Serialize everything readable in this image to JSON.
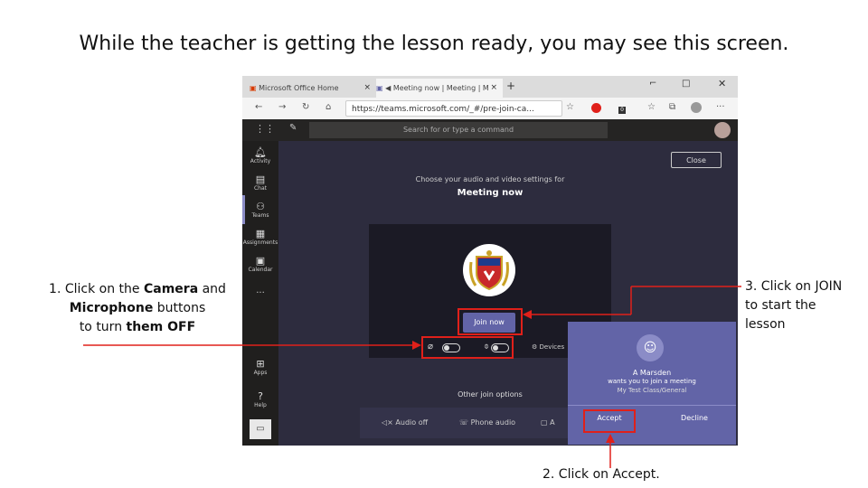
{
  "slide": {
    "title": "While the teacher is getting the lesson ready, you may see this screen.",
    "note1": {
      "p1": "1. Click on the ",
      "b1": "Camera",
      "p2": " and",
      "b2": "Microphone",
      "p3": " buttons",
      "p4": "to turn ",
      "b3": "them OFF"
    },
    "note2": "2. Click on Accept.",
    "note3": {
      "l1": "3. Click on JOIN",
      "l2": "to start the",
      "l3": "lesson"
    }
  },
  "browser": {
    "tabs": [
      {
        "label": "Microsoft Office Home",
        "close": "×"
      },
      {
        "label": "Meeting now | Meeting | M",
        "close": "×"
      }
    ],
    "new_tab": "+",
    "url": "https://teams.microsoft.com/_#/pre-join-ca...",
    "badge": "0"
  },
  "teams": {
    "search_placeholder": "Search for or type a command",
    "rail": [
      {
        "icon": "bell-icon",
        "label": "Activity"
      },
      {
        "icon": "chat-icon",
        "label": "Chat"
      },
      {
        "icon": "teams-icon",
        "label": "Teams"
      },
      {
        "icon": "assignments-icon",
        "label": "Assignments"
      },
      {
        "icon": "calendar-icon",
        "label": "Calendar"
      },
      {
        "icon": "more-icon",
        "label": "..."
      },
      {
        "icon": "apps-icon",
        "label": "Apps"
      },
      {
        "icon": "help-icon",
        "label": "Help"
      }
    ],
    "close_label": "Close",
    "choose_text": "Choose your audio and video settings for",
    "meeting_name": "Meeting now",
    "join_label": "Join now",
    "devices_label": "Devices",
    "other_join": "Other join options",
    "options": [
      "Audio off",
      "Phone audio",
      "A"
    ]
  },
  "notification": {
    "name": "A Marsden",
    "message": "wants you to join a meeting",
    "subtitle": "My Test Class/General",
    "accept_label": "Accept",
    "decline_label": "Decline"
  },
  "colors": {
    "accent": "#6264a7",
    "highlight": "#e0201a",
    "dark_bg": "#2d2c3e"
  }
}
